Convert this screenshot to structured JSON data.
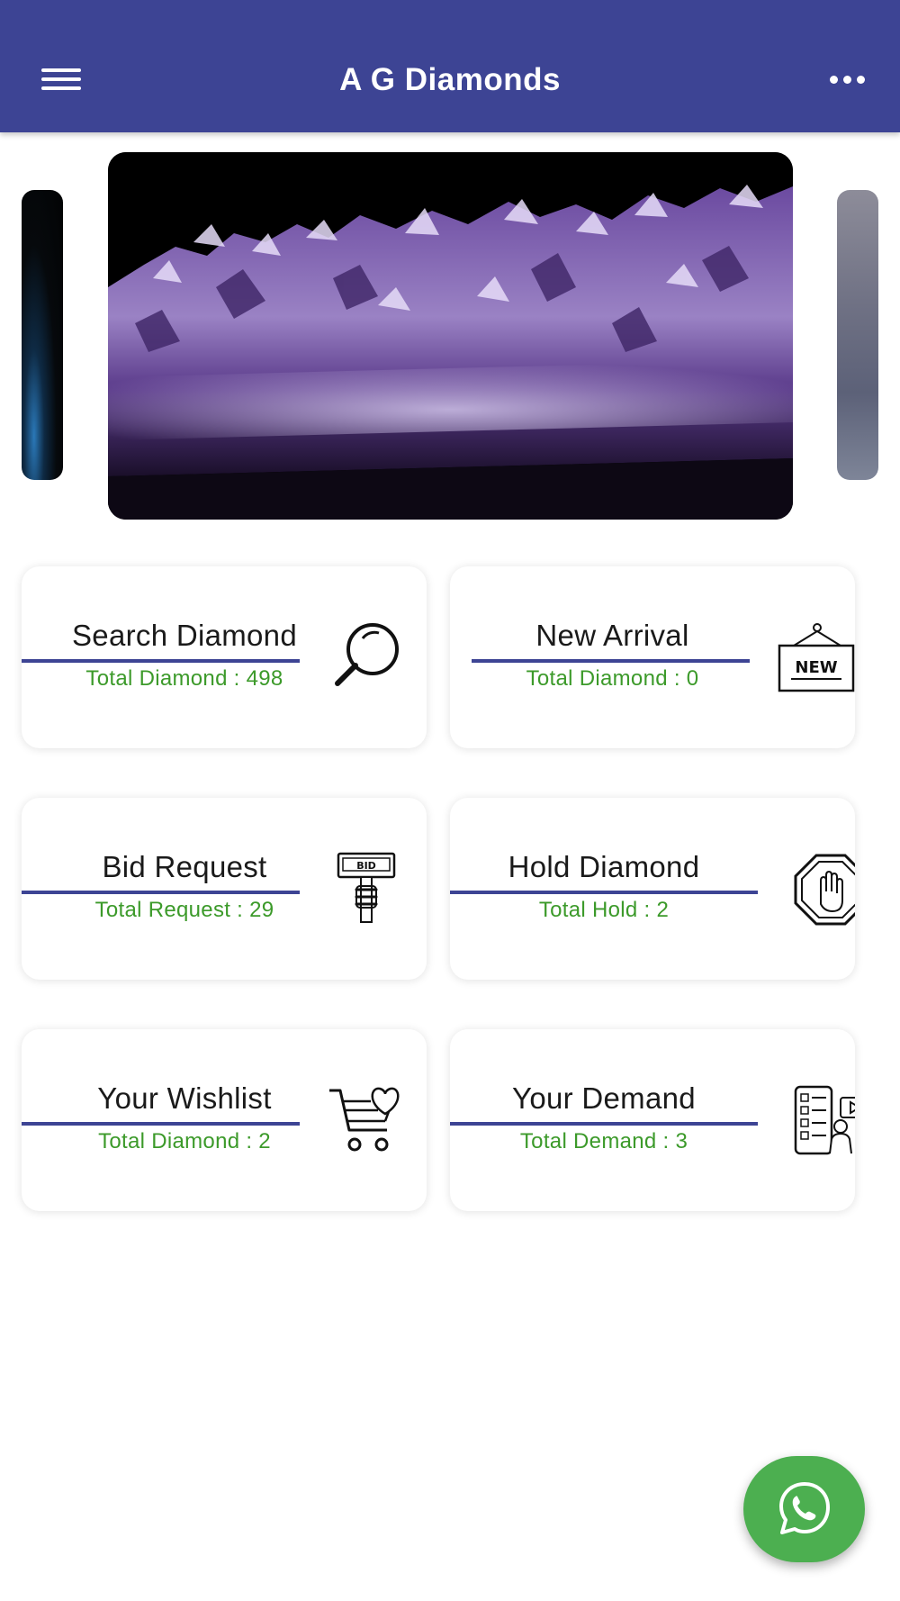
{
  "app_bar": {
    "title": "A G Diamonds",
    "menu_icon": "hamburger-menu-icon",
    "more_icon": "more-dots-icon",
    "background": "#3d4494"
  },
  "carousel": {
    "main_image": "purple amethyst crystal cluster on black background",
    "left_image": "dark blue gem edge",
    "right_image": "grey gem edge"
  },
  "cards": [
    {
      "title": "Search Diamond",
      "subtitle": "Total Diamond : 498",
      "icon": "magnifier-icon"
    },
    {
      "title": "New Arrival",
      "subtitle": "Total Diamond : 0",
      "icon": "new-sign-icon",
      "icon_text": "NEW"
    },
    {
      "title": "Bid Request",
      "subtitle": "Total Request : 29",
      "icon": "bid-paddle-icon",
      "icon_text": "BID"
    },
    {
      "title": "Hold Diamond",
      "subtitle": "Total Hold : 2",
      "icon": "stop-hand-icon"
    },
    {
      "title": "Your Wishlist",
      "subtitle": "Total Diamond : 2",
      "icon": "cart-heart-icon"
    },
    {
      "title": "Your Demand",
      "subtitle": "Total Demand : 3",
      "icon": "demand-list-icon"
    }
  ],
  "fab": {
    "icon": "whatsapp-icon"
  },
  "colors": {
    "accent": "#3d4494",
    "count_text": "#3c9a2a",
    "fab": "#4caf50"
  }
}
